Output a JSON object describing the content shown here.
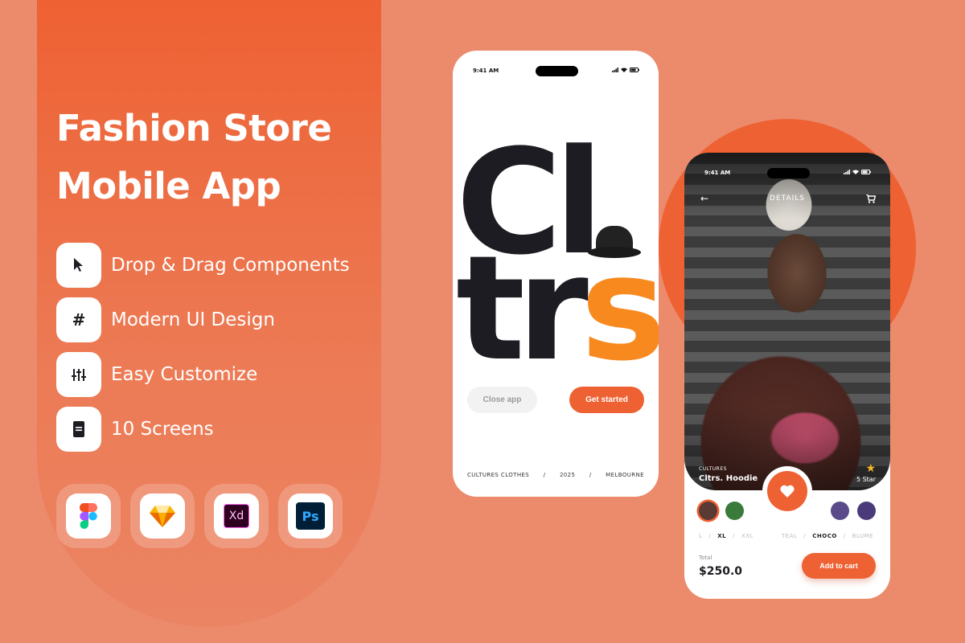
{
  "hero": {
    "title_line1": "Fashion Store",
    "title_line2": "Mobile App"
  },
  "features": [
    {
      "icon": "cursor-pointer-icon",
      "label": "Drop & Drag Components"
    },
    {
      "icon": "hashtag-icon",
      "label": "Modern UI Design"
    },
    {
      "icon": "sliders-icon",
      "label": "Easy Customize"
    },
    {
      "icon": "mobile-screen-icon",
      "label": "10 Screens"
    }
  ],
  "tools": [
    {
      "name": "Figma",
      "icon": "figma-logo-icon"
    },
    {
      "name": "Sketch",
      "icon": "sketch-logo-icon"
    },
    {
      "name": "Adobe XD",
      "icon": "xd-logo-icon",
      "text": "Xd"
    },
    {
      "name": "Photoshop",
      "icon": "ps-logo-icon",
      "text": "Ps"
    }
  ],
  "colors": {
    "accent": "#ee6133",
    "background": "#ec8a6c",
    "dark": "#1d1c22"
  },
  "phone1": {
    "status_time": "9:41 AM",
    "brand_line1": "Cl",
    "brand_line2": "tr",
    "brand_line2_last": "s",
    "close_label": "Close app",
    "start_label": "Get started",
    "footer": [
      "CULTURES CLOTHES",
      "/",
      "2025",
      "/",
      "MELBOURNE"
    ]
  },
  "phone2": {
    "status_time": "9:41 AM",
    "screen_title": "DETAILS",
    "brand": "CULTURES",
    "product_name": "Cltrs. Hoodie",
    "rating": "5 Star",
    "sizes": [
      "L",
      "XL",
      "XXL"
    ],
    "selected_size": "XL",
    "colors": [
      "TEAL",
      "CHOCO",
      "BLUME"
    ],
    "selected_color": "CHOCO",
    "total_label": "Total",
    "total_value": "$250.0",
    "add_to_cart_label": "Add to cart"
  }
}
